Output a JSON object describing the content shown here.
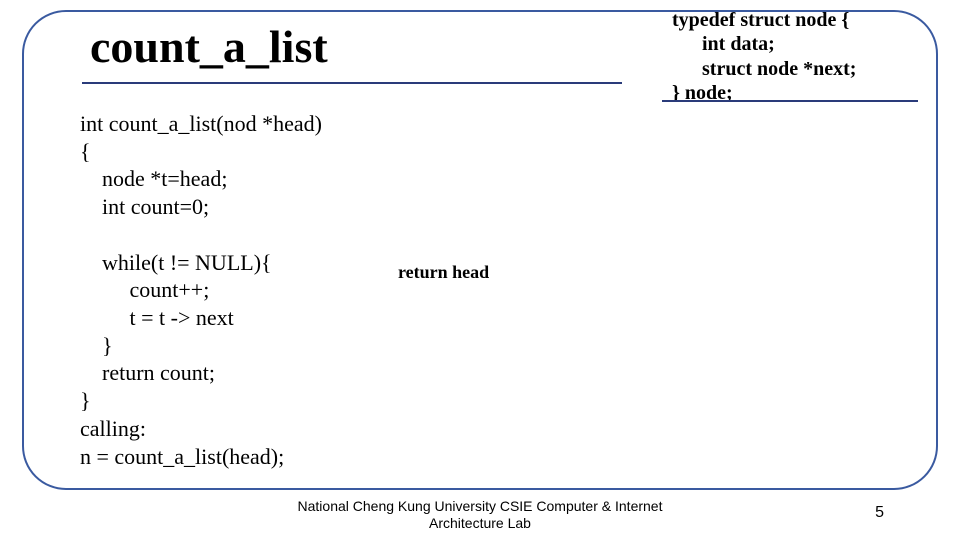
{
  "title": "count_a_list",
  "typedef": "typedef struct node {\n      int data;\n      struct node *next;\n} node;",
  "code": "int count_a_list(nod *head)\n{\n    node *t=head;\n    int count=0;\n\n    while(t != NULL){\n         count++;\n         t = t -> next\n    }\n    return count;\n}\ncalling:\nn = count_a_list(head);",
  "note": "return head",
  "footer_line1": "National Cheng Kung University CSIE Computer & Internet",
  "footer_line2": "Architecture Lab",
  "page_number": "5"
}
